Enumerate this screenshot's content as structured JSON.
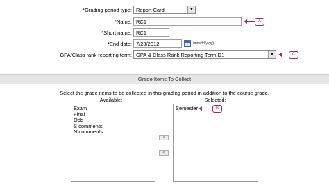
{
  "form": {
    "grading_period_type_label": "*Grading period type:",
    "grading_period_type_value": "Report Card",
    "name_label": "*Name:",
    "name_value": "RC1",
    "short_name_label": "*Short name:",
    "short_name_value": "RC1",
    "end_date_label": "*End date:",
    "end_date_value": "7/23/2012",
    "end_date_hint": "(mm/dd/yyyy)",
    "gpa_label": "GPA/Class rank reporting term:",
    "gpa_value": "GPA & Class Rank Reporting Term D1"
  },
  "callouts": {
    "a": "A",
    "b": "B",
    "c": "C"
  },
  "grade_items": {
    "section_title": "Grade Items To Collect",
    "instructions": "Select the grade items to be collected in this grading period in addition to the course grade.",
    "available_label": "Available:",
    "selected_label": "Selected:",
    "available": [
      "Exam",
      "Final",
      "Odd",
      "S comments",
      "N comments"
    ],
    "selected": [
      "Semester"
    ],
    "add_button": ">",
    "remove_button": "<"
  },
  "icons": {
    "dropdown": "chevron-down-icon",
    "calendar": "calendar-icon"
  },
  "colors": {
    "callout": "#9c2c6e",
    "section_bar": "#e6e6e6"
  }
}
